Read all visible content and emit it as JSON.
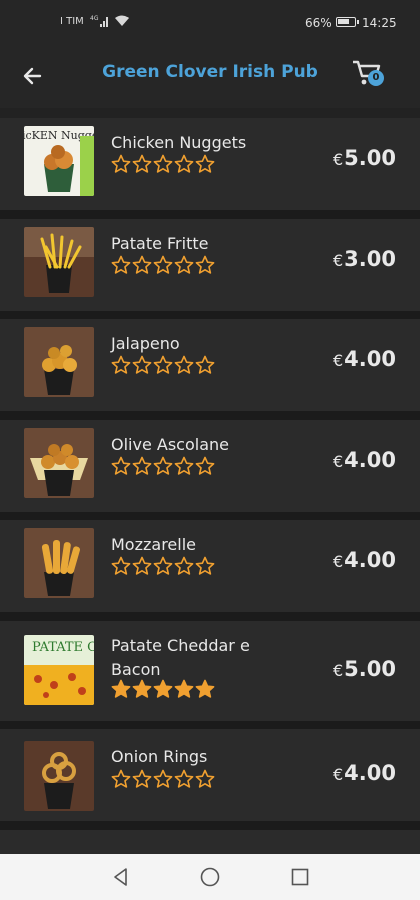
{
  "status_bar": {
    "carrier": "I TIM",
    "network": "4G",
    "battery_percent": "66%",
    "time": "14:25"
  },
  "header": {
    "title": "Green Clover Irish Pub",
    "back_icon": "arrow-left-icon",
    "cart_icon": "shopping-cart-icon",
    "cart_count": "0"
  },
  "currency_symbol": "€",
  "colors": {
    "accent": "#4da3d9",
    "star": "#f0a030",
    "background": "#222222",
    "row": "#2b2b2b"
  },
  "menu_items": [
    {
      "name": "Chicken Nuggets",
      "price": "5.00",
      "rating": 0,
      "thumb_text": "icKEN Nugge"
    },
    {
      "name": "Patate Fritte",
      "price": "3.00",
      "rating": 0
    },
    {
      "name": "Jalapeno",
      "price": "4.00",
      "rating": 0
    },
    {
      "name": "Olive Ascolane",
      "price": "4.00",
      "rating": 0
    },
    {
      "name": "Mozzarelle",
      "price": "4.00",
      "rating": 0
    },
    {
      "name": "Patate Cheddar e Bacon",
      "price": "5.00",
      "rating": 5,
      "thumb_text": "PATATE Cheddar + Bacon"
    },
    {
      "name": "Onion Rings",
      "price": "4.00",
      "rating": 0
    }
  ],
  "system_nav": {
    "back_icon": "triangle-back-icon",
    "home_icon": "circle-home-icon",
    "recent_icon": "square-recents-icon"
  }
}
